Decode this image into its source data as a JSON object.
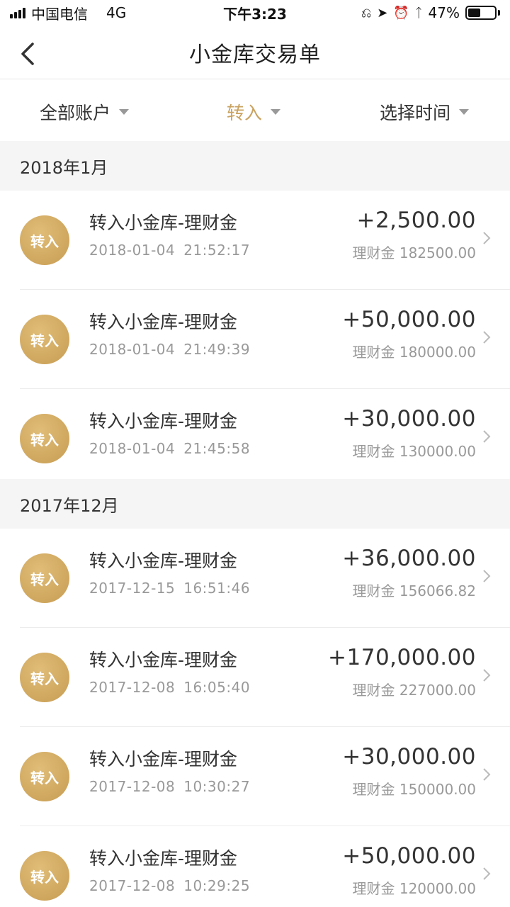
{
  "status_bar": {
    "carrier": "中国电信",
    "network": "4G",
    "time": "下午3:23",
    "battery": "47%",
    "battery_level": 0.47
  },
  "nav": {
    "title": "小金库交易单"
  },
  "filters": {
    "account": "全部账户",
    "type": "转入",
    "time": "选择时间"
  },
  "sections": [
    {
      "month": "2018年1月",
      "items": [
        {
          "badge": "转入",
          "title": "转入小金库-理财金",
          "date": "2018-01-04",
          "time": "21:52:17",
          "amount": "+2,500.00",
          "balance": "理财金 182500.00"
        },
        {
          "badge": "转入",
          "title": "转入小金库-理财金",
          "date": "2018-01-04",
          "time": "21:49:39",
          "amount": "+50,000.00",
          "balance": "理财金 180000.00"
        },
        {
          "badge": "转入",
          "title": "转入小金库-理财金",
          "date": "2018-01-04",
          "time": "21:45:58",
          "amount": "+30,000.00",
          "balance": "理财金 130000.00"
        }
      ]
    },
    {
      "month": "2017年12月",
      "items": [
        {
          "badge": "转入",
          "title": "转入小金库-理财金",
          "date": "2017-12-15",
          "time": "16:51:46",
          "amount": "+36,000.00",
          "balance": "理财金 156066.82"
        },
        {
          "badge": "转入",
          "title": "转入小金库-理财金",
          "date": "2017-12-08",
          "time": "16:05:40",
          "amount": "+170,000.00",
          "balance": "理财金 227000.00"
        },
        {
          "badge": "转入",
          "title": "转入小金库-理财金",
          "date": "2017-12-08",
          "time": "10:30:27",
          "amount": "+30,000.00",
          "balance": "理财金 150000.00"
        },
        {
          "badge": "转入",
          "title": "转入小金库-理财金",
          "date": "2017-12-08",
          "time": "10:29:25",
          "amount": "+50,000.00",
          "balance": "理财金 120000.00"
        }
      ]
    }
  ],
  "colors": {
    "accent": "#c9a25f",
    "badge": "#d4ad65",
    "section_bg": "#f5f5f5"
  }
}
